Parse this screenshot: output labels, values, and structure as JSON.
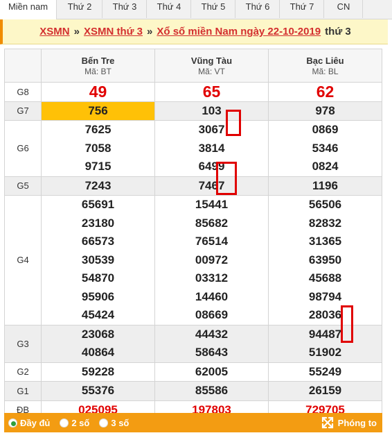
{
  "tabs": [
    {
      "label": "Miền nam",
      "active": true
    },
    {
      "label": "Thứ 2"
    },
    {
      "label": "Thứ 3"
    },
    {
      "label": "Thứ 4"
    },
    {
      "label": "Thứ 5"
    },
    {
      "label": "Thứ 6"
    },
    {
      "label": "Thứ 7"
    },
    {
      "label": "CN"
    }
  ],
  "breadcrumb": {
    "link1": "XSMN",
    "sep1": "»",
    "link2": "XSMN thứ 3",
    "sep2": "»",
    "link3": "Xổ số miền Nam ngày 22-10-2019",
    "suffix": "thứ 3"
  },
  "provinces": [
    {
      "name": "Bến Tre",
      "code": "Mã: BT"
    },
    {
      "name": "Vũng Tàu",
      "code": "Mã: VT"
    },
    {
      "name": "Bạc Liêu",
      "code": "Mã: BL"
    }
  ],
  "prizes": {
    "g8": {
      "label": "G8",
      "values": [
        [
          "49"
        ],
        [
          "65"
        ],
        [
          "62"
        ]
      ]
    },
    "g7": {
      "label": "G7",
      "values": [
        [
          "756"
        ],
        [
          "103"
        ],
        [
          "978"
        ]
      ]
    },
    "g6": {
      "label": "G6",
      "values": [
        [
          "7625",
          "7058",
          "9715"
        ],
        [
          "3067",
          "3814",
          "6499"
        ],
        [
          "0869",
          "5346",
          "0824"
        ]
      ]
    },
    "g5": {
      "label": "G5",
      "values": [
        [
          "7243"
        ],
        [
          "7467"
        ],
        [
          "1196"
        ]
      ]
    },
    "g4": {
      "label": "G4",
      "values": [
        [
          "65691",
          "23180",
          "66573",
          "30539",
          "54870",
          "95906",
          "45424"
        ],
        [
          "15441",
          "85682",
          "76514",
          "00972",
          "03312",
          "14460",
          "08669"
        ],
        [
          "56506",
          "82832",
          "31365",
          "63950",
          "45688",
          "98794",
          "28036"
        ]
      ]
    },
    "g3": {
      "label": "G3",
      "values": [
        [
          "23068",
          "40864"
        ],
        [
          "44432",
          "58643"
        ],
        [
          "94487",
          "51902"
        ]
      ]
    },
    "g2": {
      "label": "G2",
      "values": [
        [
          "59228"
        ],
        [
          "62005"
        ],
        [
          "55249"
        ]
      ]
    },
    "g1": {
      "label": "G1",
      "values": [
        [
          "55376"
        ],
        [
          "85586"
        ],
        [
          "26159"
        ]
      ]
    },
    "db": {
      "label": "ĐB",
      "values": [
        [
          "025095"
        ],
        [
          "197803"
        ],
        [
          "729705"
        ]
      ]
    }
  },
  "footer": {
    "options": [
      {
        "label": "Đầy đủ",
        "selected": true
      },
      {
        "label": "2 số"
      },
      {
        "label": "3 số"
      }
    ],
    "zoom_label": "Phóng to",
    "zoom_icon": "expand-arrows-icon"
  },
  "colors": {
    "accent_red": "#e10000",
    "highlight": "#ffc107",
    "footer_bg": "#f39c12",
    "crumb_bg": "#fdf7c8"
  }
}
